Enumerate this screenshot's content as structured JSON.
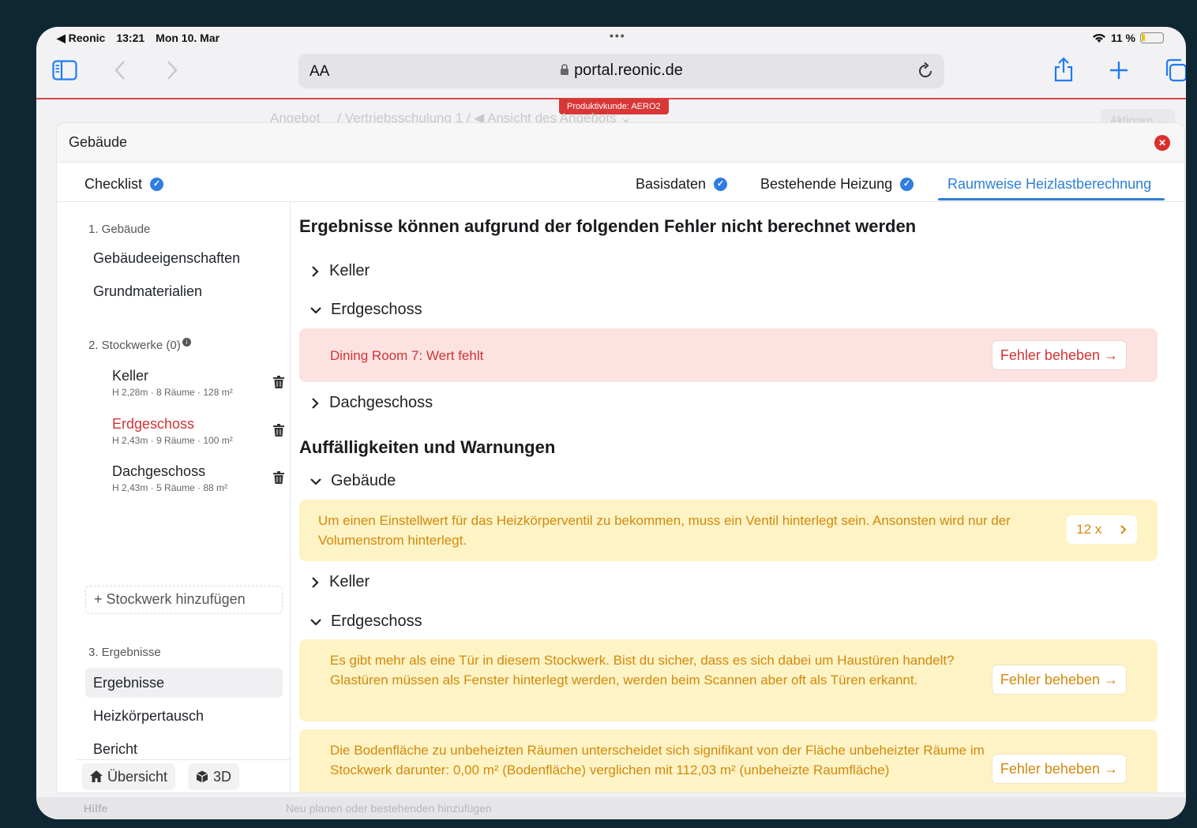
{
  "statusbar": {
    "back_app": "◀ Reonic",
    "time": "13:21",
    "date": "Mon 10. Mar",
    "dots": "•••",
    "wifi": "▾",
    "battery": "11 %"
  },
  "browser": {
    "aa": "AA",
    "url": "portal.reonic.de",
    "prod_tag": "Produktivkunde: AERO2"
  },
  "background": {
    "crumb_main": "Angebot",
    "crumb_rest": "/ Vertriebsschulung 1 / ◀ Ansicht des Angebots ⌄",
    "actions": "Aktionen ⌄",
    "help": "Hilfe",
    "hint": "Neu planen oder bestehenden hinzufügen"
  },
  "modal": {
    "title": "Gebäude",
    "tabs": {
      "checklist": "Checklist",
      "basisdaten": "Basisdaten",
      "heizung": "Bestehende Heizung",
      "heizlast": "Raumweise Heizlastberechnung"
    }
  },
  "sidebar": {
    "sec1": "1. Gebäude",
    "eigenschaften": "Gebäudeeigenschaften",
    "materialien": "Grundmaterialien",
    "sec2": "2. Stockwerke (0)",
    "floors": [
      {
        "name": "Keller",
        "meta": "H 2,28m · 8 Räume · 128 m²"
      },
      {
        "name": "Erdgeschoss",
        "meta": "H 2,43m · 9 Räume · 100 m²"
      },
      {
        "name": "Dachgeschoss",
        "meta": "H 2,43m · 5 Räume · 88 m²"
      }
    ],
    "add_floor": "+ Stockwerk hinzufügen",
    "sec3": "3. Ergebnisse",
    "ergebnisse": "Ergebnisse",
    "heizkoerper": "Heizkörpertausch",
    "bericht": "Bericht",
    "overview": "Übersicht",
    "view3d": "3D"
  },
  "main": {
    "errors_title": "Ergebnisse können aufgrund der folgenden Fehler nicht berechnet werden",
    "err_keller": "Keller",
    "err_eg": "Erdgeschoss",
    "err_eg_msg": "Dining Room 7: Wert fehlt",
    "err_dg": "Dachgeschoss",
    "fix_label": "Fehler beheben →",
    "warnings_title": "Auffälligkeiten und Warnungen",
    "warn_gebaeude": "Gebäude",
    "warn_gebaeude_msg": "Um einen Einstellwert für das Heizkörperventil zu bekommen, muss ein Ventil hinterlegt sein. Ansonsten wird nur der Volumenstrom hinterlegt.",
    "warn_count": "12 x",
    "warn_keller": "Keller",
    "warn_eg": "Erdgeschoss",
    "warn_eg_msg1": "Es gibt mehr als eine Tür in diesem Stockwerk. Bist du sicher, dass es sich dabei um Haustüren handelt? Glastüren müssen als Fenster hinterlegt werden, werden beim Scannen aber oft als Türen erkannt.",
    "warn_eg_msg2": "Die Bodenfläche zu unbeheizten Räumen unterscheidet sich signifikant von der Fläche unbeheizter Räume im Stockwerk darunter: 0,00 m² (Bodenfläche) verglichen mit 112,03 m² (unbeheizte Raumfläche)"
  },
  "colors": {
    "accent": "#2d7fd6",
    "error": "#d03434",
    "warning": "#d3890c",
    "error_bg": "#fde2e2",
    "warning_bg": "#fdf3c5"
  }
}
